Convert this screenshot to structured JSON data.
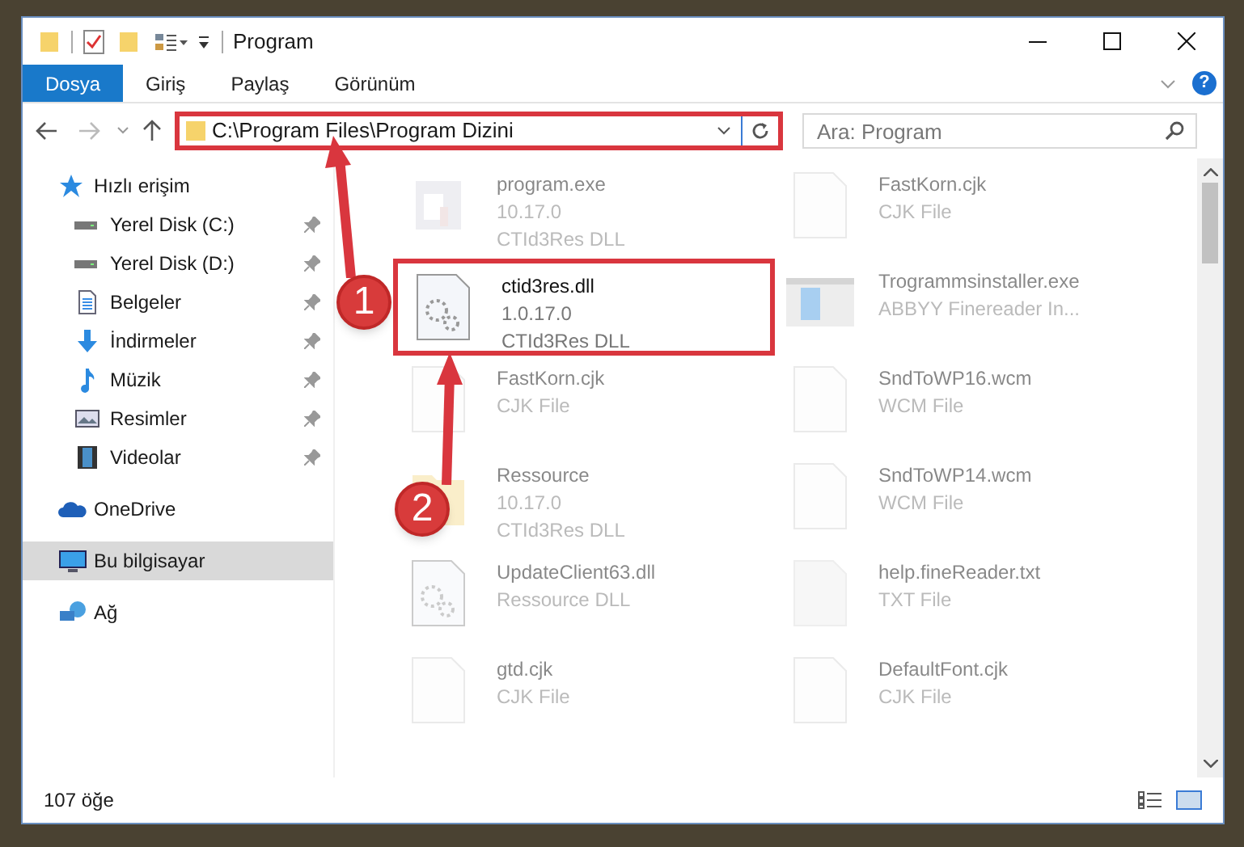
{
  "window": {
    "title": "Program"
  },
  "ribbon_tabs": [
    {
      "label": "Dosya",
      "selected": true
    },
    {
      "label": "Giriş",
      "selected": false
    },
    {
      "label": "Paylaş",
      "selected": false
    },
    {
      "label": "Görünüm",
      "selected": false
    }
  ],
  "address": {
    "path": "C:\\Program Files\\Program Dizini"
  },
  "help": {
    "label": "?"
  },
  "search": {
    "placeholder": "Ara: Program"
  },
  "sidebar": {
    "items": [
      {
        "label": "Hızlı erişim",
        "kind": "star",
        "pinned": false,
        "selected": false,
        "indent": false
      },
      {
        "label": "Yerel Disk (C:)",
        "kind": "drive",
        "pinned": true,
        "selected": false,
        "indent": true
      },
      {
        "label": "Yerel Disk (D:)",
        "kind": "drive",
        "pinned": true,
        "selected": false,
        "indent": true
      },
      {
        "label": "Belgeler",
        "kind": "document",
        "pinned": true,
        "selected": false,
        "indent": true
      },
      {
        "label": "İndirmeler",
        "kind": "download",
        "pinned": true,
        "selected": false,
        "indent": true
      },
      {
        "label": "Müzik",
        "kind": "music",
        "pinned": true,
        "selected": false,
        "indent": true
      },
      {
        "label": "Resimler",
        "kind": "picture",
        "pinned": true,
        "selected": false,
        "indent": true
      },
      {
        "label": "Videolar",
        "kind": "video",
        "pinned": true,
        "selected": false,
        "indent": true
      },
      {
        "label": "OneDrive",
        "kind": "cloud",
        "pinned": false,
        "selected": false,
        "indent": false
      },
      {
        "label": "Bu bilgisayar",
        "kind": "computer",
        "pinned": false,
        "selected": true,
        "indent": false
      },
      {
        "label": "Ağ",
        "kind": "network",
        "pinned": false,
        "selected": false,
        "indent": false
      }
    ]
  },
  "files": [
    {
      "name": "program.exe",
      "lines": [
        "10.17.0",
        "CTId3Res DLL"
      ],
      "kind": "exe",
      "highlighted": false
    },
    {
      "name": "FastKorn.cjk",
      "lines": [
        "CJK File"
      ],
      "kind": "blank",
      "highlighted": false
    },
    {
      "name": "ctid3res.dll",
      "lines": [
        "1.0.17.0",
        "CTId3Res DLL"
      ],
      "kind": "dll",
      "highlighted": true
    },
    {
      "name": "Trogrammsinstaller.exe",
      "lines": [
        "ABBYY Finereader In..."
      ],
      "kind": "installer",
      "highlighted": false
    },
    {
      "name": "FastKorn.cjk",
      "lines": [
        "CJK File"
      ],
      "kind": "blank",
      "highlighted": false
    },
    {
      "name": "SndToWP16.wcm",
      "lines": [
        "WCM File"
      ],
      "kind": "blank",
      "highlighted": false
    },
    {
      "name": "Ressource",
      "lines": [
        "10.17.0",
        "CTId3Res DLL"
      ],
      "kind": "folder",
      "highlighted": false
    },
    {
      "name": "SndToWP14.wcm",
      "lines": [
        "WCM File"
      ],
      "kind": "blank",
      "highlighted": false
    },
    {
      "name": "UpdateClient63.dll",
      "lines": [
        "Ressource DLL"
      ],
      "kind": "dll",
      "highlighted": false
    },
    {
      "name": "help.fineReader.txt",
      "lines": [
        "TXT File"
      ],
      "kind": "text",
      "highlighted": false
    },
    {
      "name": "gtd.cjk",
      "lines": [
        "CJK File"
      ],
      "kind": "blank",
      "highlighted": false
    },
    {
      "name": "DefaultFont.cjk",
      "lines": [
        "CJK File"
      ],
      "kind": "blank",
      "highlighted": false
    }
  ],
  "status_bar": {
    "count": "107 öğe"
  },
  "annotations": [
    {
      "label": "1"
    },
    {
      "label": "2"
    }
  ]
}
